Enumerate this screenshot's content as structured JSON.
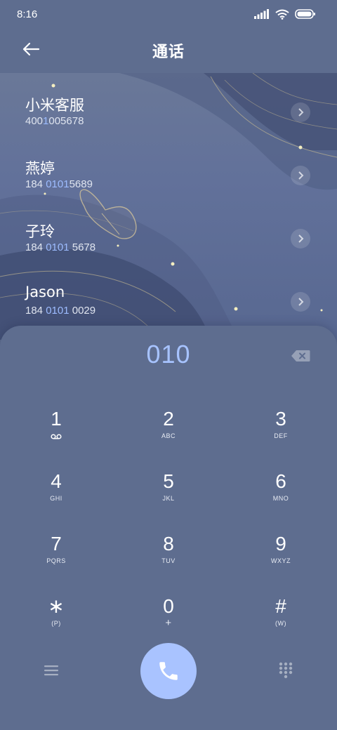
{
  "status_bar": {
    "time": "8:16"
  },
  "header": {
    "title": "通话"
  },
  "contacts": [
    {
      "name": "小米客服",
      "number_parts": [
        "400",
        "1",
        "005678"
      ]
    },
    {
      "name": "燕婷",
      "number_parts": [
        "184 ",
        "0101",
        "5689"
      ]
    },
    {
      "name": "子玲",
      "number_parts": [
        "184 ",
        "0101",
        " 5678"
      ]
    },
    {
      "name": "Jason",
      "number_parts": [
        "184 ",
        "0101",
        " 0029"
      ]
    }
  ],
  "dialpad": {
    "input": "010",
    "keys": [
      {
        "digit": "1",
        "letters": ""
      },
      {
        "digit": "2",
        "letters": "ABC"
      },
      {
        "digit": "3",
        "letters": "DEF"
      },
      {
        "digit": "4",
        "letters": "GHI"
      },
      {
        "digit": "5",
        "letters": "JKL"
      },
      {
        "digit": "6",
        "letters": "MNO"
      },
      {
        "digit": "7",
        "letters": "PQRS"
      },
      {
        "digit": "8",
        "letters": "TUV"
      },
      {
        "digit": "9",
        "letters": "WXYZ"
      },
      {
        "digit": "∗",
        "letters": "(P)"
      },
      {
        "digit": "0",
        "letters": "+"
      },
      {
        "digit": "#",
        "letters": "(W)"
      }
    ]
  },
  "colors": {
    "background": "#5e6d8f",
    "accent": "#a9c3ff",
    "highlight": "#9dbcff"
  },
  "icons": [
    "signal-icon",
    "wifi-icon",
    "battery-icon",
    "back-arrow-icon",
    "chevron-right-icon",
    "backspace-icon",
    "voicemail-icon",
    "menu-icon",
    "phone-icon",
    "keypad-icon"
  ]
}
